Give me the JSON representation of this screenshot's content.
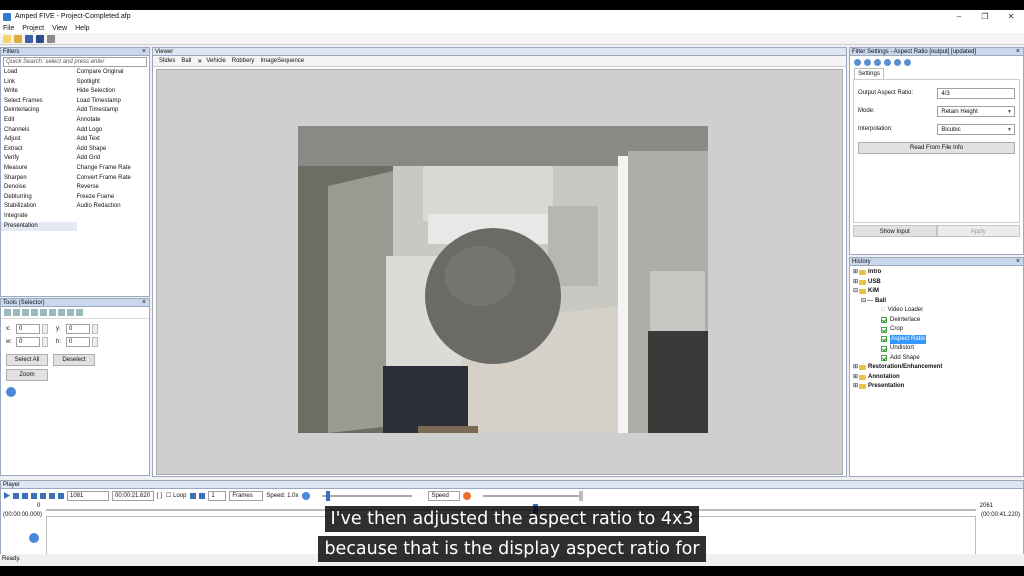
{
  "window": {
    "title": "Amped FIVE - Project-Completed.afp",
    "controls": [
      "–",
      "❐",
      "✕"
    ]
  },
  "menu": [
    "File",
    "Project",
    "View",
    "Help"
  ],
  "filters": {
    "header": "Filters",
    "search_placeholder": "Quick Search: select and press enter",
    "col1": [
      "Load",
      "Link",
      "Write",
      "Select Frames",
      "Deinterlacing",
      "Edit",
      "Channels",
      "Adjust",
      "Extract",
      "Verify",
      "Measure",
      "Sharpen",
      "Denoise",
      "Deblurring",
      "Stabilization",
      "Integrate",
      "Presentation"
    ],
    "col2": [
      "Compare Original",
      "Spotlight",
      "Hide Selection",
      "Load Timestamp",
      "Add Timestamp",
      "Annotate",
      "Add Logo",
      "Add Text",
      "Add Shape",
      "Add Grid",
      "Change Frame Rate",
      "Convert Frame Rate",
      "Reverse",
      "Freeze Frame",
      "Audio Redaction"
    ]
  },
  "tools": {
    "header": "Tools (Selector)",
    "x_label": "x:",
    "x": "0",
    "y_label": "y:",
    "y": "0",
    "w_label": "w:",
    "w": "0",
    "h_label": "h:",
    "h": "0",
    "select_all": "Select All",
    "deselect": "Deselect",
    "zoom": "Zoom"
  },
  "viewer": {
    "header": "Viewer",
    "tabs": [
      "Slides",
      "Ball",
      "Vehicle",
      "Robbery",
      "ImageSequence"
    ]
  },
  "filter_settings": {
    "header": "Filter Settings - Aspect Ratio [output] [updated]",
    "tab": "Settings",
    "output_aspect_label": "Output Aspect Ratio:",
    "output_aspect": "4/3",
    "mode_label": "Mode:",
    "mode": "Retain Height",
    "interp_label": "Interpolation:",
    "interp": "Bicubic",
    "read_btn": "Read From File Info",
    "show_input": "Show Input",
    "apply": "Apply"
  },
  "history": {
    "header": "History",
    "intro": "Intro",
    "usb": "USB",
    "kim": "KiM",
    "ball": "Ball",
    "steps": [
      "Video Loader",
      "Deinterlace",
      "Crop",
      "Aspect Ratio",
      "Undistort",
      "Add Shape"
    ],
    "others": [
      "Restoration/Enhancement",
      "Annotation",
      "Presentation"
    ]
  },
  "player": {
    "header": "Player",
    "frame": "1081",
    "time": "00:00:21.620",
    "bracket": "[ ]",
    "loop": "Loop",
    "step": "1",
    "unit": "Frames",
    "speed_label": "Speed: 1.0x",
    "speed_mode": "Speed",
    "start_frame": "0",
    "start_time": "(00:00:00.000)",
    "end_frame": "2061",
    "end_time": "(00:00:41.220)"
  },
  "status": "Ready.",
  "captions": [
    "I've then adjusted the aspect ratio to 4x3",
    "because that is the display aspect ratio for"
  ]
}
